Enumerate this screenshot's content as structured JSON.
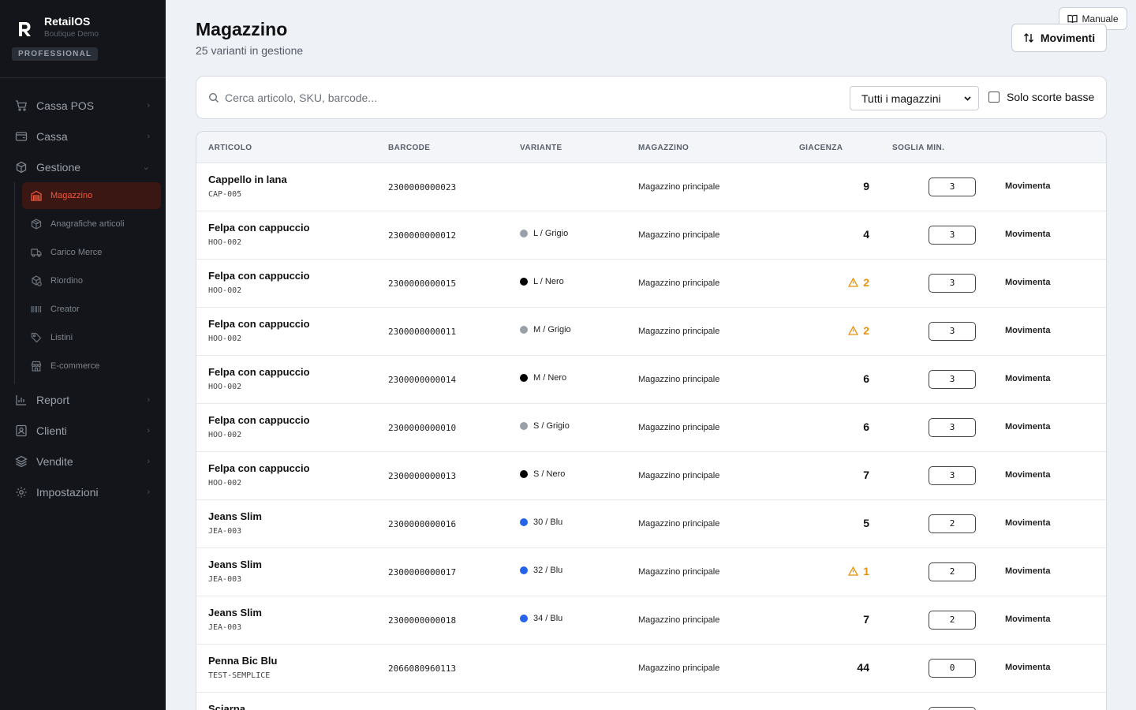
{
  "brand": {
    "name": "RetailOS",
    "subtitle": "Boutique Demo",
    "plan": "PROFESSIONAL"
  },
  "sidebar": {
    "items_top": [
      {
        "label": "Cassa POS",
        "icon": "cart-icon"
      },
      {
        "label": "Cassa",
        "icon": "register-icon"
      },
      {
        "label": "Gestione",
        "icon": "boxes-icon",
        "expanded": true
      }
    ],
    "sub_items": [
      {
        "label": "Magazzino",
        "icon": "warehouse-icon",
        "active": true
      },
      {
        "label": "Anagrafiche articoli",
        "icon": "package-icon"
      },
      {
        "label": "Carico Merce",
        "icon": "truck-icon"
      },
      {
        "label": "Riordino",
        "icon": "reorder-icon"
      },
      {
        "label": "Creator",
        "icon": "barcode-icon"
      },
      {
        "label": "Listini",
        "icon": "tag-icon"
      },
      {
        "label": "E-commerce",
        "icon": "store-icon"
      }
    ],
    "items_bottom": [
      {
        "label": "Report",
        "icon": "chart-icon"
      },
      {
        "label": "Clienti",
        "icon": "contacts-icon"
      },
      {
        "label": "Vendite",
        "icon": "layers-icon"
      },
      {
        "label": "Impostazioni",
        "icon": "gear-icon"
      }
    ]
  },
  "header": {
    "title": "Magazzino",
    "subtitle": "25 varianti in gestione",
    "manual_label": "Manuale",
    "movements_label": "Movimenti"
  },
  "filters": {
    "search_placeholder": "Cerca articolo, SKU, barcode...",
    "warehouse_selected": "Tutti i magazzini",
    "low_stock_label": "Solo scorte basse",
    "low_stock_checked": false
  },
  "table": {
    "columns": [
      "ARTICOLO",
      "BARCODE",
      "VARIANTE",
      "MAGAZZINO",
      "GIACENZA",
      "SOGLIA MIN."
    ],
    "action_label": "Movimenta",
    "rows": [
      {
        "name": "Cappello in lana",
        "sku": "CAP-005",
        "barcode": "2300000000023",
        "variant": "",
        "variant_color": "",
        "warehouse": "Magazzino principale",
        "stock": "9",
        "low": false,
        "min": "3"
      },
      {
        "name": "Felpa con cappuccio",
        "sku": "HOO-002",
        "barcode": "2300000000012",
        "variant": "L / Grigio",
        "variant_color": "#9aa0a8",
        "warehouse": "Magazzino principale",
        "stock": "4",
        "low": false,
        "min": "3"
      },
      {
        "name": "Felpa con cappuccio",
        "sku": "HOO-002",
        "barcode": "2300000000015",
        "variant": "L / Nero",
        "variant_color": "#000000",
        "warehouse": "Magazzino principale",
        "stock": "2",
        "low": true,
        "min": "3"
      },
      {
        "name": "Felpa con cappuccio",
        "sku": "HOO-002",
        "barcode": "2300000000011",
        "variant": "M / Grigio",
        "variant_color": "#9aa0a8",
        "warehouse": "Magazzino principale",
        "stock": "2",
        "low": true,
        "min": "3"
      },
      {
        "name": "Felpa con cappuccio",
        "sku": "HOO-002",
        "barcode": "2300000000014",
        "variant": "M / Nero",
        "variant_color": "#000000",
        "warehouse": "Magazzino principale",
        "stock": "6",
        "low": false,
        "min": "3"
      },
      {
        "name": "Felpa con cappuccio",
        "sku": "HOO-002",
        "barcode": "2300000000010",
        "variant": "S / Grigio",
        "variant_color": "#9aa0a8",
        "warehouse": "Magazzino principale",
        "stock": "6",
        "low": false,
        "min": "3"
      },
      {
        "name": "Felpa con cappuccio",
        "sku": "HOO-002",
        "barcode": "2300000000013",
        "variant": "S / Nero",
        "variant_color": "#000000",
        "warehouse": "Magazzino principale",
        "stock": "7",
        "low": false,
        "min": "3"
      },
      {
        "name": "Jeans Slim",
        "sku": "JEA-003",
        "barcode": "2300000000016",
        "variant": "30 / Blu",
        "variant_color": "#2563eb",
        "warehouse": "Magazzino principale",
        "stock": "5",
        "low": false,
        "min": "2"
      },
      {
        "name": "Jeans Slim",
        "sku": "JEA-003",
        "barcode": "2300000000017",
        "variant": "32 / Blu",
        "variant_color": "#2563eb",
        "warehouse": "Magazzino principale",
        "stock": "1",
        "low": true,
        "min": "2"
      },
      {
        "name": "Jeans Slim",
        "sku": "JEA-003",
        "barcode": "2300000000018",
        "variant": "34 / Blu",
        "variant_color": "#2563eb",
        "warehouse": "Magazzino principale",
        "stock": "7",
        "low": false,
        "min": "2"
      },
      {
        "name": "Penna Bic Blu",
        "sku": "TEST-SEMPLICE",
        "barcode": "2066080960113",
        "variant": "",
        "variant_color": "",
        "warehouse": "Magazzino principale",
        "stock": "44",
        "low": false,
        "min": "0"
      },
      {
        "name": "Sciarpa",
        "sku": "",
        "barcode": "",
        "variant": "",
        "variant_color": "",
        "warehouse": "",
        "stock": "",
        "low": false,
        "min": ""
      }
    ]
  },
  "colors": {
    "accent": "#f2563a",
    "warning": "#e8920e",
    "sidebar_bg": "#13151a"
  }
}
